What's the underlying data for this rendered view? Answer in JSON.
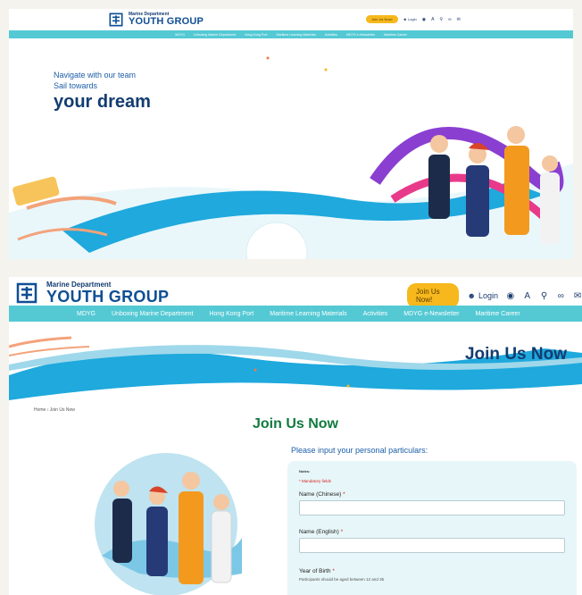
{
  "panel1": {
    "logo": {
      "sub": "Marine Department",
      "main": "YOUTH GROUP"
    },
    "header": {
      "join_label": "Join Us Now!",
      "login_label": "Login"
    },
    "nav": [
      "MDYG",
      "Unboxing Marine Department",
      "Hong Kong Port",
      "Maritime Learning Materials",
      "Activities",
      "MDYG e-Newsletter",
      "Maritime Career"
    ],
    "hero": {
      "line1": "Navigate with our team",
      "line2": "Sail towards",
      "line3": "your dream"
    }
  },
  "panel2": {
    "logo": {
      "sub": "Marine Department",
      "main": "YOUTH GROUP"
    },
    "header": {
      "join_label": "Join Us Now!",
      "login_label": "Login"
    },
    "nav": [
      "MDYG",
      "Unboxing Marine Department",
      "Hong Kong Port",
      "Maritime Learning Materials",
      "Activities",
      "MDYG e-Newsletter",
      "Maritime Career"
    ],
    "banner_title": "Join Us Now",
    "breadcrumb": "Home › Join Us Now",
    "page_title": "Join Us Now",
    "form": {
      "heading": "Please input your personal particulars:",
      "notes": "Notes:",
      "mandatory": "* Mandatory fields",
      "name_chinese_label": "Name (Chinese)",
      "name_english_label": "Name (English)",
      "yob_label": "Year of Birth",
      "yob_hint": "Participants should be aged between 12 and 35",
      "required_mark": "*"
    }
  },
  "colors": {
    "nav_bg": "#54c9d4",
    "brand_blue": "#0f4f94",
    "join_yellow": "#f6b81c",
    "title_green": "#117a3f",
    "required_red": "#d9221c"
  },
  "icons": [
    "user-icon",
    "globe-icon",
    "font-size-icon",
    "search-icon",
    "link-icon",
    "mail-icon"
  ]
}
